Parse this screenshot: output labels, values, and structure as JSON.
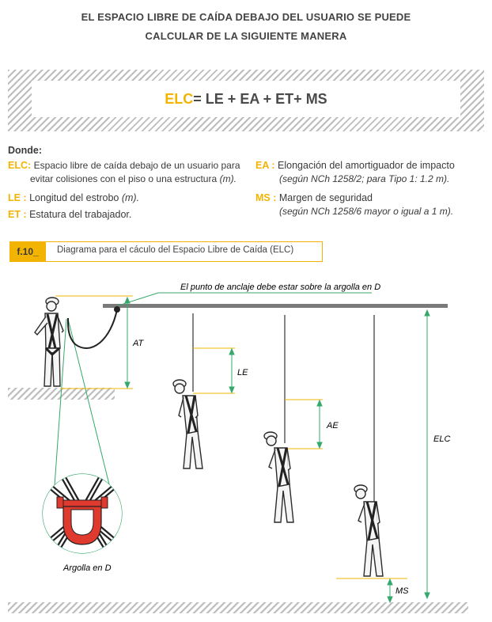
{
  "header": {
    "line1": "EL ESPACIO LIBRE DE CAÍDA DEBAJO DEL USUARIO SE PUEDE",
    "line2": "CALCULAR DE LA SIGUIENTE MANERA"
  },
  "formula": {
    "acronym": "ELC",
    "rest": "= LE + EA + ET+ MS"
  },
  "definitions": {
    "title": "Donde:",
    "left": [
      {
        "key": "ELC:",
        "text1": "Espacio libre de caída debajo de un usuario para",
        "text2": "evitar colisiones con el piso o una estructura",
        "italic2": "(m)."
      },
      {
        "key": "LE :",
        "text1": "Longitud del estrobo",
        "italic1": "(m)."
      },
      {
        "key": "ET :",
        "text1": "Estatura del trabajador."
      }
    ],
    "right": [
      {
        "key": "EA :",
        "text1": "Elongación del amortiguador de impacto",
        "italic2": "(según NCh 1258/2; para Tipo 1: 1.2 m)."
      },
      {
        "key": "MS :",
        "text1": "Margen de seguridad",
        "italic2": "(según NCh 1258/6 mayor o igual a 1 m)."
      }
    ]
  },
  "figure": {
    "tag": "f.10_",
    "caption": "Diagrama para el cáculo del Espacio Libre de Caída (ELC)"
  },
  "diagram": {
    "anchor_note": "El punto de anclaje debe estar sobre la argolla en D",
    "labels": {
      "at": "AT",
      "le": "LE",
      "ae": "AE",
      "elc": "ELC",
      "ms": "MS"
    },
    "ring_caption": "Argolla en D"
  },
  "colors": {
    "accent": "#f2b400",
    "rod": "#777777",
    "harness": "#2b2b2b",
    "ring": "#e03a2f",
    "guide": "#35a86b"
  }
}
